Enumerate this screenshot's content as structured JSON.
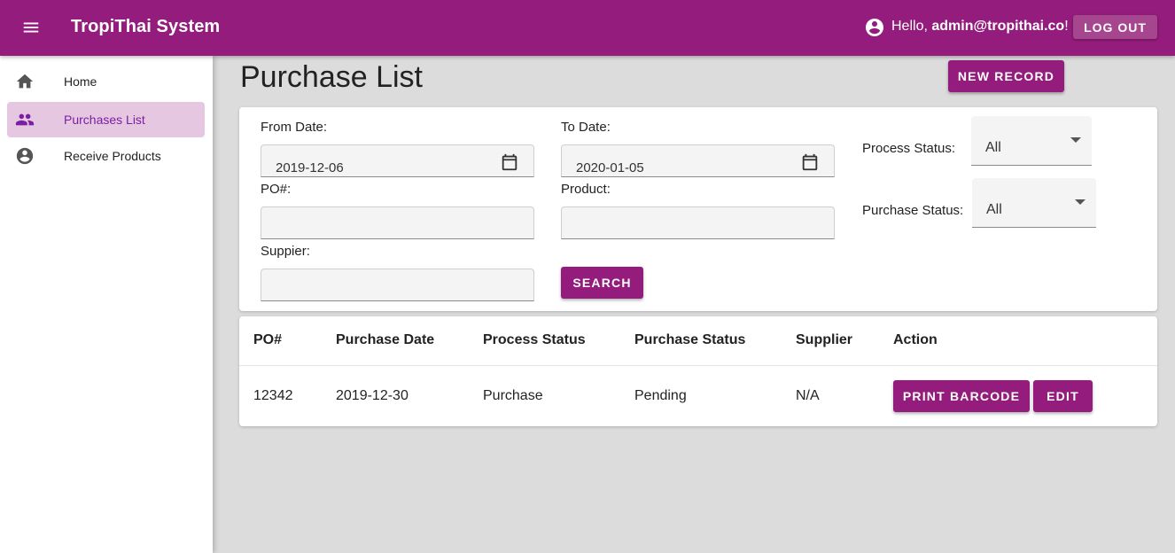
{
  "appbar": {
    "title": "TropiThai System",
    "greeting_prefix": "Hello, ",
    "user_email": "admin@tropithai.co",
    "greeting_suffix": "!",
    "logout_label": "LOG OUT"
  },
  "sidebar": {
    "items": [
      {
        "label": "Home",
        "icon": "home-icon"
      },
      {
        "label": "Purchases List",
        "icon": "people-icon",
        "active": true
      },
      {
        "label": "Receive Products",
        "icon": "account-circle-icon"
      }
    ]
  },
  "main": {
    "title": "Purchase List",
    "new_record_label": "NEW RECORD"
  },
  "filters": {
    "from_date": {
      "label": "From Date:",
      "value": "2019-12-06"
    },
    "to_date": {
      "label": "To Date:",
      "value": "2020-01-05"
    },
    "po": {
      "label": "PO#:",
      "value": ""
    },
    "product": {
      "label": "Product:",
      "value": ""
    },
    "supplier": {
      "label": "Suppier:",
      "value": ""
    },
    "process_status": {
      "label": "Process Status:",
      "value": "All"
    },
    "purchase_status": {
      "label": "Purchase Status:",
      "value": "All"
    },
    "search_label": "SEARCH"
  },
  "table": {
    "headers": [
      "PO#",
      "Purchase Date",
      "Process Status",
      "Purchase Status",
      "Supplier",
      "Action"
    ],
    "rows": [
      {
        "po": "12342",
        "purchase_date": "2019-12-30",
        "process_status": "Purchase",
        "purchase_status": "Pending",
        "supplier": "N/A"
      }
    ],
    "print_barcode_label": "PRINT BARCODE",
    "edit_label": "EDIT"
  },
  "colors": {
    "primary": "#941c7c",
    "sidebar_active_bg": "#e6c7e1",
    "sidebar_active_text": "#7b1fa2",
    "page_bg": "#dcdcdc"
  }
}
